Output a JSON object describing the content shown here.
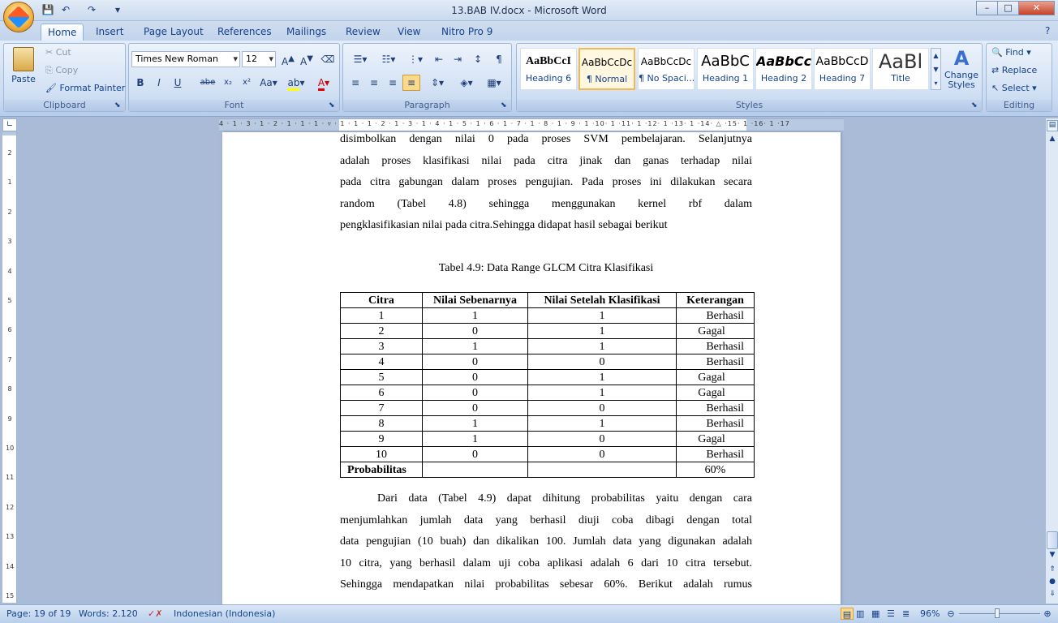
{
  "window": {
    "title": "13.BAB IV.docx - Microsoft Word",
    "controls": [
      "–",
      "□",
      "✕"
    ]
  },
  "qat": [
    "save-icon",
    "undo-icon",
    "redo-icon",
    "customize-icon"
  ],
  "tabs": [
    "Home",
    "Insert",
    "Page Layout",
    "References",
    "Mailings",
    "Review",
    "View",
    "Nitro Pro 9"
  ],
  "clipboard": {
    "paste": "Paste",
    "cut": "Cut",
    "copy": "Copy",
    "format_painter": "Format Painter",
    "label": "Clipboard"
  },
  "font": {
    "name": "Times New Roman",
    "size": "12",
    "label": "Font"
  },
  "paragraph": {
    "label": "Paragraph"
  },
  "styles": {
    "items": [
      {
        "preview": "AaBbCcI",
        "name": "Heading 6"
      },
      {
        "preview": "AaBbCcDc",
        "name": "¶ Normal"
      },
      {
        "preview": "AaBbCcDc",
        "name": "¶ No Spaci..."
      },
      {
        "preview": "AaBbC",
        "name": "Heading 1"
      },
      {
        "preview": "AaBbCc",
        "name": "Heading 2"
      },
      {
        "preview": "AaBbCcD",
        "name": "Heading 7"
      },
      {
        "preview": "AaBl",
        "name": "Title"
      }
    ],
    "change_styles": "Change Styles",
    "label": "Styles"
  },
  "editing": {
    "find": "Find",
    "replace": "Replace",
    "select": "Select",
    "label": "Editing"
  },
  "document": {
    "para1_lines": [
      "disimbolkan dengan nilai 0 pada proses SVM pembelajaran. Selanjutnya",
      "adalah proses klasifikasi nilai pada citra jinak dan ganas terhadap nilai",
      "pada citra gabungan dalam proses pengujian. Pada proses ini dilakukan secara",
      "random (Tabel 4.8) sehingga menggunakan kernel rbf dalam",
      "pengklasifikasian nilai pada citra.Sehingga didapat hasil sebagai berikut"
    ],
    "caption": "Tabel 4.9: Data Range GLCM Citra Klasifikasi",
    "table": {
      "headers": [
        "Citra",
        "Nilai Sebenarnya",
        "Nilai Setelah Klasifikasi",
        "Keterangan"
      ],
      "rows": [
        [
          "1",
          "1",
          "1",
          "Berhasil"
        ],
        [
          "2",
          "0",
          "1",
          "Gagal"
        ],
        [
          "3",
          "1",
          "1",
          "Berhasil"
        ],
        [
          "4",
          "0",
          "0",
          "Berhasil"
        ],
        [
          "5",
          "0",
          "1",
          "Gagal"
        ],
        [
          "6",
          "0",
          "1",
          "Gagal"
        ],
        [
          "7",
          "0",
          "0",
          "Berhasil"
        ],
        [
          "8",
          "1",
          "1",
          "Berhasil"
        ],
        [
          "9",
          "1",
          "0",
          "Gagal"
        ],
        [
          "10",
          "0",
          "0",
          "Berhasil"
        ]
      ],
      "footer": [
        "Probabilitas",
        "",
        "",
        "60%"
      ]
    },
    "para2_lines": [
      "Dari data (Tabel 4.9) dapat dihitung probabilitas yaitu dengan cara",
      "menjumlahkan jumlah data yang berhasil diuji coba dibagi dengan total",
      "data pengujian (10 buah) dan dikalikan 100. Jumlah data yang digunakan adalah",
      "10 citra, yang berhasil dalam uji coba aplikasi adalah 6 dari 10 citra tersebut.",
      "Sehingga mendapatkan nilai probabilitas sebesar 60%. Berikut adalah rumus"
    ]
  },
  "status": {
    "page": "Page: 19 of 19",
    "words": "Words: 2.120",
    "language": "Indonesian (Indonesia)",
    "zoom": "96%"
  }
}
